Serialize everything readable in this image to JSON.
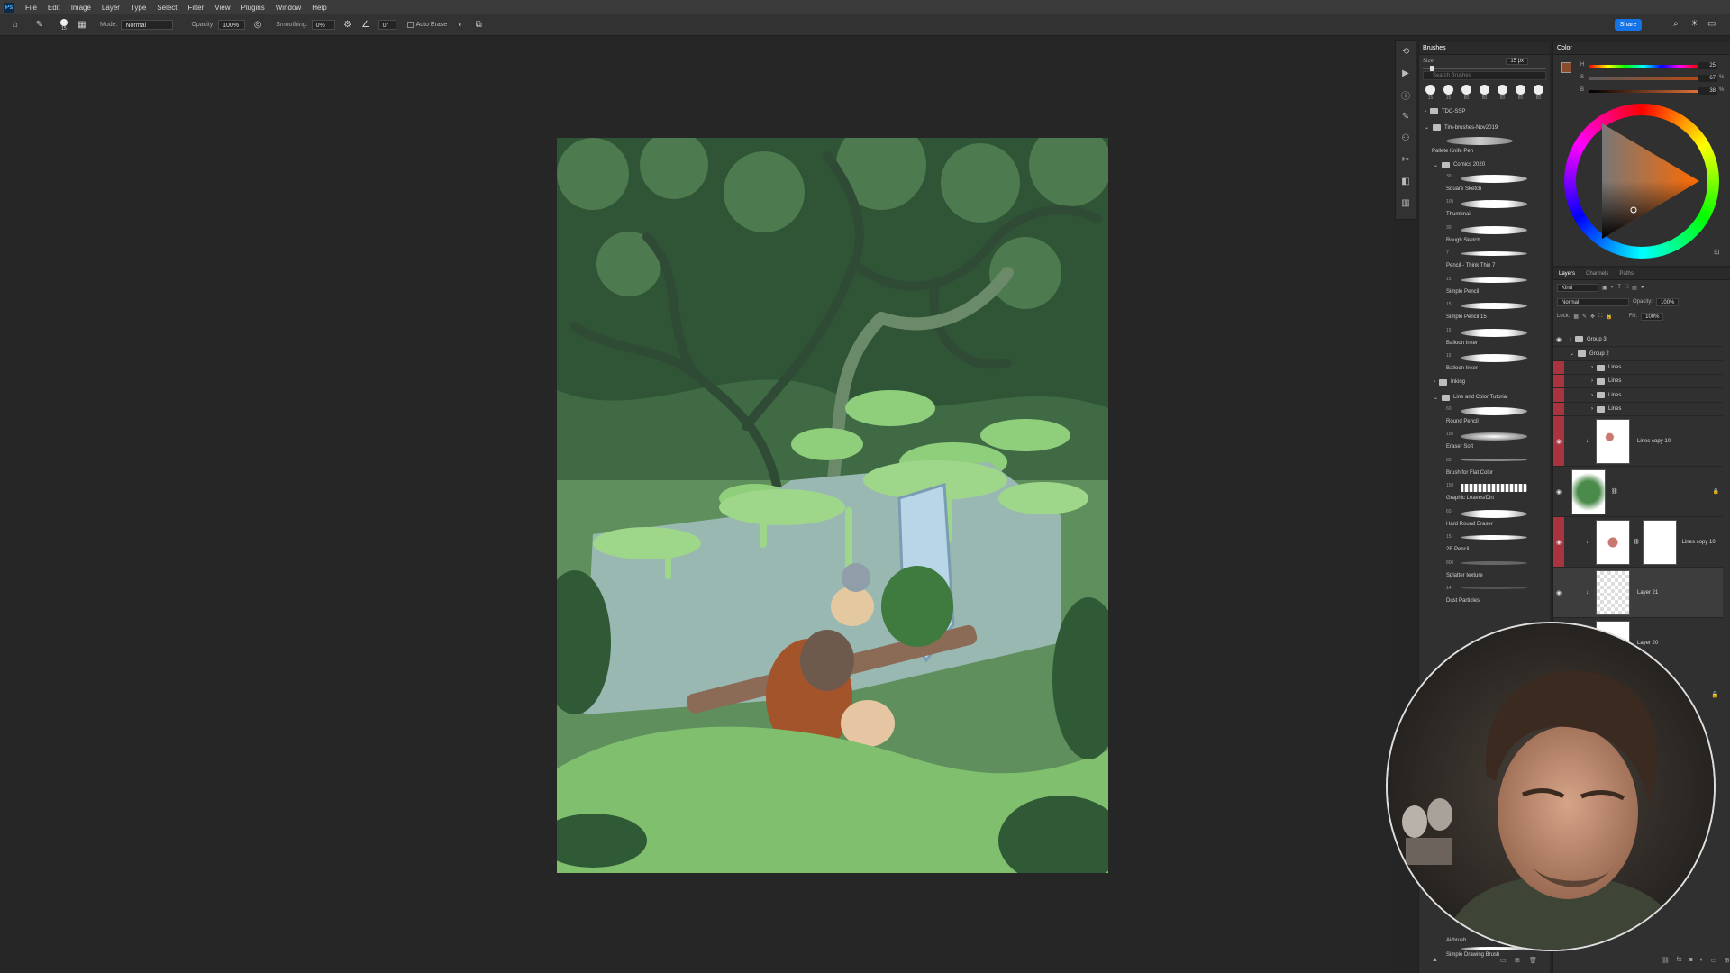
{
  "menubar": {
    "logo": "Ps",
    "items": [
      "File",
      "Edit",
      "Image",
      "Layer",
      "Type",
      "Select",
      "Filter",
      "View",
      "Plugins",
      "Window",
      "Help"
    ]
  },
  "options": {
    "brush_size": "15",
    "mode_label": "Mode:",
    "mode_value": "Normal",
    "opacity_label": "Opacity:",
    "opacity_value": "100%",
    "smoothing_label": "Smoothing:",
    "smoothing_value": "0%",
    "angle_value": "0°",
    "auto_erase": "Auto Erase",
    "share": "Share"
  },
  "brushes": {
    "title": "Brushes",
    "size_label": "Size:",
    "size_value": "15 px",
    "search_placeholder": "Search Brushes",
    "presets": [
      "15",
      "15",
      "80",
      "80",
      "80",
      "80",
      "80"
    ],
    "groups": {
      "tdc": "TDC-SSP",
      "tim": "Tim-brushes-Nov2019",
      "palette_knife": "Pallete Knife Pen",
      "comics": "Comics 2020",
      "inking": "Inking",
      "line_color": "Line and Color Tutorial"
    },
    "comics_items": [
      {
        "size": "30",
        "name": "Square Sketch"
      },
      {
        "size": "100",
        "name": "Thumbnail"
      },
      {
        "size": "30",
        "name": "Rough Sketch"
      },
      {
        "size": "7",
        "name": "Pencil - Think Thin 7"
      },
      {
        "size": "15",
        "name": "Simple Pencil"
      },
      {
        "size": "15",
        "name": "Simple Pencil 15"
      },
      {
        "size": "15",
        "name": "Balloon Inker"
      },
      {
        "size": "15",
        "name": "Balloon Inker"
      }
    ],
    "tutorial_items": [
      {
        "size": "60",
        "name": "Round Pencil"
      },
      {
        "size": "150",
        "name": "Eraser Soft"
      },
      {
        "size": "83",
        "name": "Brush for Flat Color"
      },
      {
        "size": "150",
        "name": "Graphic Leaves/Dirt"
      },
      {
        "size": "60",
        "name": "Hard Round Eraser"
      },
      {
        "size": "15",
        "name": "2B Pencil"
      },
      {
        "size": "800",
        "name": "Splatter texture"
      },
      {
        "size": "14",
        "name": "Dust Particles"
      }
    ],
    "bottom_items": [
      "Airbrush",
      "Simple Drawing Brush"
    ]
  },
  "color": {
    "title": "Color",
    "h_label": "H",
    "h_value": "25",
    "s_label": "S",
    "s_value": "67",
    "s_unit": "%",
    "b_label": "B",
    "b_value": "38",
    "b_unit": "%",
    "foreground": "#8a4a2c",
    "background": "#ffffff"
  },
  "layers": {
    "tabs": [
      "Layers",
      "Channels",
      "Paths"
    ],
    "filter_kind": "Kind",
    "blend_mode": "Normal",
    "opacity_label": "Opacity:",
    "opacity_value": "100%",
    "lock_label": "Lock:",
    "fill_label": "Fill:",
    "fill_value": "100%",
    "items": [
      {
        "name": "Group 3"
      },
      {
        "name": "Group 2"
      },
      {
        "name": "Lines"
      },
      {
        "name": "Lines"
      },
      {
        "name": "Lines"
      },
      {
        "name": "Lines"
      },
      {
        "name": "Lines copy 10"
      },
      {
        "name": "Lines copy 10"
      },
      {
        "name": "Layer 21"
      },
      {
        "name": "Layer 20"
      }
    ]
  }
}
